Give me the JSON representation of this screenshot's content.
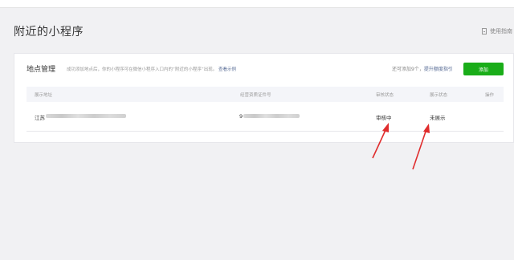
{
  "page": {
    "title": "附近的小程序",
    "guide_label": "使用指南"
  },
  "card": {
    "title": "地点管理",
    "description": "成功添加地点后，你的小程序可在微信小程序入口内的“附近的小程序”出现。",
    "example_link": "查看示例",
    "remaining_text": "还可添加9个，",
    "quota_link": "提升额度指引",
    "add_button": "添加"
  },
  "table": {
    "headers": [
      "展示地址",
      "经营资质证件号",
      "审核状态",
      "展示状态",
      "操作"
    ],
    "rows": [
      {
        "address_prefix": "江苏",
        "license_prefix": "9",
        "review_status": "审核中",
        "display_status": "未展示"
      }
    ]
  },
  "annotation": {
    "arrow_color": "#e02d2d"
  }
}
